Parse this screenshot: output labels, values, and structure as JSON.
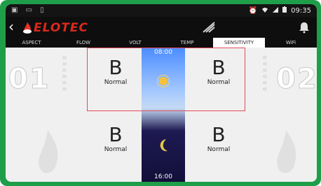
{
  "status_bar": {
    "time": "09:35",
    "left_icons": "▣ ▭ ▯"
  },
  "app_bar": {
    "brand": "ELOTEC"
  },
  "tabs": [
    {
      "label": "ASPECT"
    },
    {
      "label": "FLOW"
    },
    {
      "label": "VOLT"
    },
    {
      "label": "TEMP"
    },
    {
      "label": "SENSITIVITY",
      "active": true
    },
    {
      "label": "WiFi"
    }
  ],
  "detectors": {
    "left_number": "01",
    "right_number": "02"
  },
  "schedule": {
    "day_start": "08:00",
    "night_start": "16:00"
  },
  "cells": {
    "day_left": {
      "value": "B",
      "label": "Normal"
    },
    "day_right": {
      "value": "B",
      "label": "Normal"
    },
    "night_left": {
      "value": "B",
      "label": "Normal"
    },
    "night_right": {
      "value": "B",
      "label": "Normal"
    }
  },
  "colors": {
    "frame": "#1f9e4a",
    "brand": "#d92a1c",
    "highlight_border": "#e24a5a"
  }
}
